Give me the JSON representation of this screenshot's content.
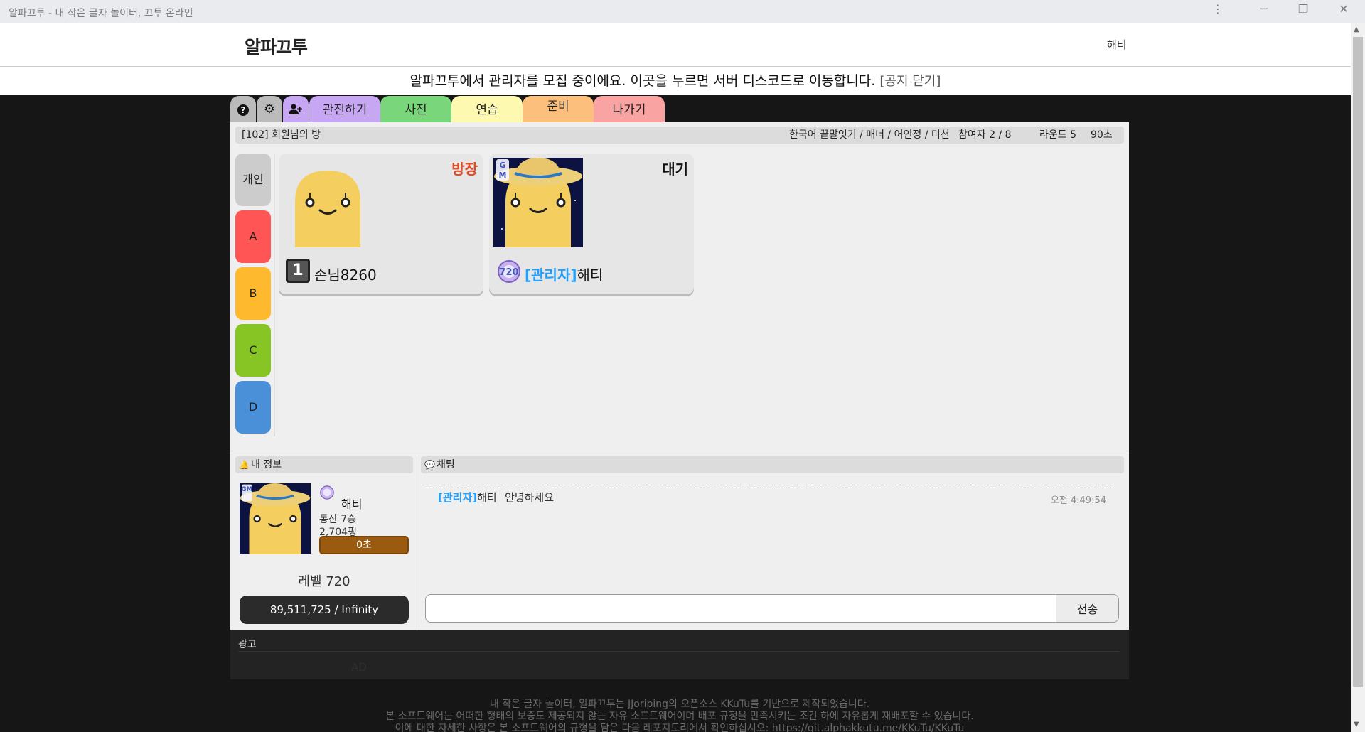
{
  "window": {
    "title": "알파끄투 - 내 작은 글자 놀이터, 끄투 온라인",
    "menu_icon": "⋮",
    "minimize_icon": "─",
    "restore_icon": "❐",
    "close_icon": "✕"
  },
  "header": {
    "logo": "알파끄투",
    "user": "해티"
  },
  "notice": {
    "text": "알파끄투에서 관리자를 모집 중이에요. 이곳을 누르면 서버 디스코드로 이동합니다.",
    "close": "[공지 닫기]"
  },
  "toolbar": {
    "help_icon": "?",
    "settings_icon": "⚙",
    "invite_icon": "+",
    "tabs": [
      {
        "label": "관전하기",
        "color": "#c7a6f3"
      },
      {
        "label": "사전",
        "color": "#7ad67a"
      },
      {
        "label": "연습",
        "color": "#fdf9b0"
      },
      {
        "label": "준비",
        "color": "#fdc07c"
      },
      {
        "label": "나가기",
        "color": "#f9a3a3"
      }
    ]
  },
  "room": {
    "title_prefix": "[102]",
    "title": "회원님의 방",
    "mode": "한국어 끝말잇기 / 매너 / 어인정 / 미션",
    "players": "참여자 2 / 8",
    "rounds": "라운드 5",
    "time": "90초"
  },
  "teams": [
    {
      "label": "개인",
      "color": "#cccccc"
    },
    {
      "label": "A",
      "color": "#ff5555"
    },
    {
      "label": "B",
      "color": "#ffb92e"
    },
    {
      "label": "C",
      "color": "#86c523"
    },
    {
      "label": "D",
      "color": "#4a90d9"
    }
  ],
  "players": [
    {
      "status": "방장",
      "status_color": "#e34d26",
      "level": "1",
      "name": "손님8260",
      "admin_tag": ""
    },
    {
      "status": "대기",
      "status_color": "#111111",
      "level": "720",
      "name": "해티",
      "admin_tag": "[관리자]"
    }
  ],
  "myinfo": {
    "header": "내 정보",
    "name": "해티",
    "wins": "통산 7승",
    "ping": "2,704핑",
    "timer": "0초",
    "level": "레벨 720",
    "exp": "89,511,725 / Infinity",
    "level_icon": "720",
    "gm_badge": "GM"
  },
  "chat": {
    "header": "채팅",
    "messages": [
      {
        "tag": "[관리자]",
        "user": "해티",
        "text": "안녕하세요",
        "time": "오전 4:49:54"
      }
    ],
    "input_value": "",
    "send": "전송"
  },
  "ad": {
    "label": "광고",
    "text": "AD"
  },
  "footer": {
    "line1": "내 작은 글자 놀이터, 알파끄투는 JJoriping의 오픈소스 KKuTu를 기반으로 제작되었습니다.",
    "line2": "본 소프트웨어는 어떠한 형태의 보증도 제공되지 않는 자유 소프트웨어이며 배포 규정을 만족시키는 조건 하에 자유롭게 재배포할 수 있습니다.",
    "line3": "이에 대한 자세한 사항은 본 소프트웨어의 규형을 담은 다음 레포지토리에서 확인하십시오:  https://git.alphakkutu.me/KKuTu/KKuTu"
  }
}
